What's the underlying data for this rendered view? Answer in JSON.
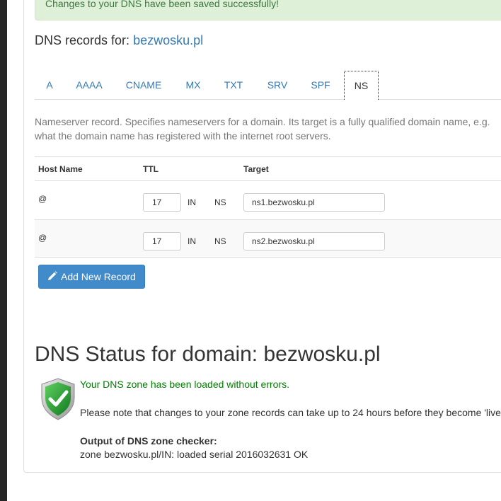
{
  "alert": {
    "message": "Changes to your DNS have been saved successfully!"
  },
  "records": {
    "title_prefix": "DNS records for:",
    "domain": "bezwosku.pl"
  },
  "tabs": [
    {
      "label": "A"
    },
    {
      "label": "AAAA"
    },
    {
      "label": "CNAME"
    },
    {
      "label": "MX"
    },
    {
      "label": "TXT"
    },
    {
      "label": "SRV"
    },
    {
      "label": "SPF"
    },
    {
      "label": "NS",
      "active": true
    }
  ],
  "description": {
    "line1": "Nameserver record. Specifies nameservers for a domain. Its target is a fully qualified domain name, e.g.",
    "line2": "what the domain name has registered with the internet root servers."
  },
  "table": {
    "headers": {
      "host": "Host Name",
      "ttl": "TTL",
      "target": "Target"
    },
    "rows": [
      {
        "host": "@",
        "ttl": "17",
        "class": "IN",
        "type": "NS",
        "target": "ns1.bezwosku.pl"
      },
      {
        "host": "@",
        "ttl": "17",
        "class": "IN",
        "type": "NS",
        "target": "ns2.bezwosku.pl"
      }
    ]
  },
  "add_button": {
    "label": "Add New Record",
    "icon": "pencil-icon",
    "color": "#428bca"
  },
  "status": {
    "title": "DNS Status for domain: bezwosku.pl",
    "icon": "shield-check-icon",
    "ok_message": "Your DNS zone has been loaded without errors.",
    "note": "Please note that changes to your zone records can take up to 24 hours before they become 'live'",
    "output_label": "Output of DNS zone checker:",
    "output_value": "zone bezwosku.pl/IN: loaded serial 2016032631 OK"
  },
  "colors": {
    "link": "#337ab7",
    "success_text": "#008000",
    "alert_bg": "#dff0d8",
    "alert_text": "#3c763d"
  }
}
